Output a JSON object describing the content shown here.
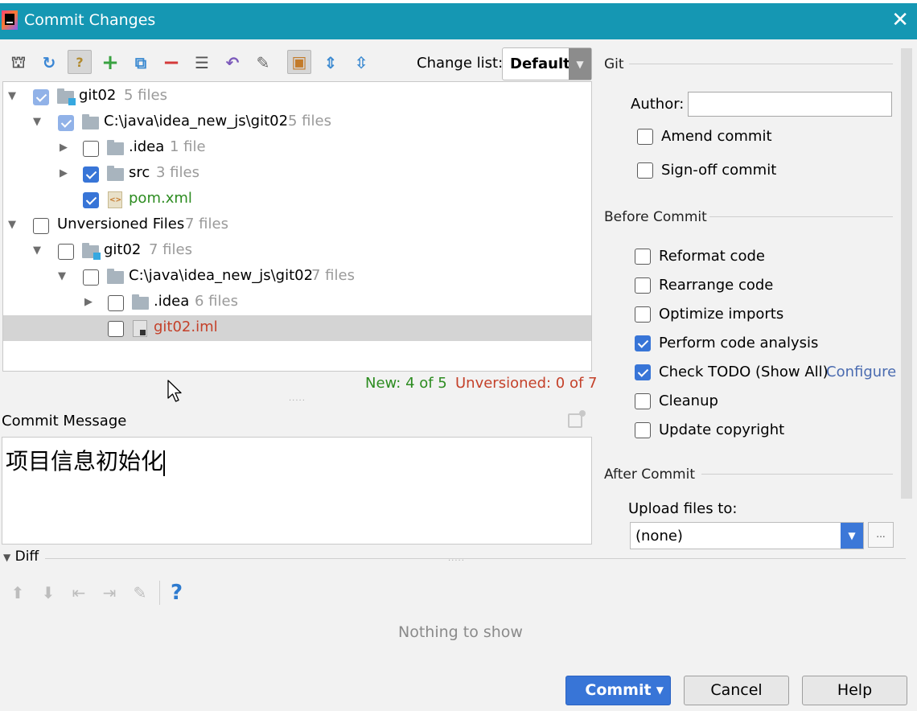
{
  "window": {
    "title": "Commit Changes"
  },
  "toolbar": {
    "icons": [
      "commit-history-icon",
      "refresh-icon",
      "help-annotate-icon",
      "add-icon",
      "move-icon",
      "remove-icon",
      "diff-icon",
      "revert-icon",
      "edit-icon",
      "group-by-icon",
      "expand-all-icon",
      "collapse-all-icon"
    ]
  },
  "changelist": {
    "label": "Change list:",
    "value": "Default"
  },
  "tree": [
    {
      "label": "git02",
      "count": "5 files"
    },
    {
      "label": "C:\\java\\idea_new_js\\git02",
      "count": "5 files"
    },
    {
      "label": ".idea",
      "count": "1 file"
    },
    {
      "label": "src",
      "count": "3 files"
    },
    {
      "label": "pom.xml",
      "count": ""
    },
    {
      "label": "Unversioned Files",
      "count": "7 files"
    },
    {
      "label": "git02",
      "count": "7 files"
    },
    {
      "label": "C:\\java\\idea_new_js\\git02",
      "count": "7 files"
    },
    {
      "label": ".idea",
      "count": "6 files"
    },
    {
      "label": "git02.iml",
      "count": ""
    }
  ],
  "stats": {
    "new": "New: 4 of 5",
    "unversioned": "Unversioned: 0 of 7"
  },
  "commit_message": {
    "label": "Commit Message",
    "text": "项目信息初始化"
  },
  "git": {
    "title": "Git",
    "author_label": "Author:",
    "author_value": "",
    "amend": "Amend commit",
    "signoff": "Sign-off commit"
  },
  "before_commit": {
    "title": "Before Commit",
    "reformat": "Reformat code",
    "rearrange": "Rearrange code",
    "optimize": "Optimize imports",
    "analysis": "Perform code analysis",
    "todo": "Check TODO (Show All)",
    "configure": "Configure",
    "cleanup": "Cleanup",
    "copyright": "Update copyright"
  },
  "after_commit": {
    "title": "After Commit",
    "upload_label": "Upload files to:",
    "upload_value": "(none)",
    "ellipsis": "..."
  },
  "diff": {
    "label": "Diff",
    "empty": "Nothing to show",
    "help": "?"
  },
  "buttons": {
    "commit": "Commit",
    "cancel": "Cancel",
    "help": "Help"
  },
  "colors": {
    "title_bar": "#1597b3",
    "accent": "#3875d7",
    "added_file": "#2d8c21",
    "unversioned_file": "#c4412a"
  }
}
